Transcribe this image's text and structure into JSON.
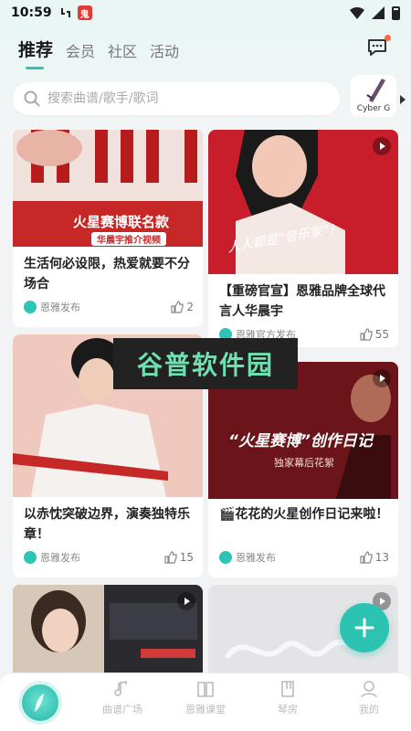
{
  "status_bar": {
    "time": "10:59",
    "app_badge": "鬼"
  },
  "header": {
    "tabs": [
      {
        "label": "推荐"
      },
      {
        "label": "会员"
      },
      {
        "label": "社区"
      },
      {
        "label": "活动"
      }
    ],
    "search_placeholder": "搜索曲谱/歌手/歌词",
    "promo_label": "Cyber G"
  },
  "feed": [
    {
      "title": "生活何必设限，热爱就要不分场合",
      "author": "恩雅发布",
      "likes": "2",
      "overlay_text": "火星赛博联名款",
      "overlay_sub": "华晨宇推介视频"
    },
    {
      "title": "【重磅官宣】恩雅品牌全球代言人华晨宇",
      "author": "恩雅官方发布",
      "likes": "55",
      "overlay_text": "人人都是“音乐家”！"
    },
    {
      "title": "以赤忱突破边界，演奏独特乐章！",
      "author": "恩雅发布",
      "likes": "15"
    },
    {
      "title": "🎬花花的火星创作日记来啦！",
      "author": "恩雅发布",
      "likes": "13",
      "overlay_text": "“火星赛博”创作日记",
      "overlay_sub": "独家幕后花絮"
    },
    {
      "title": "",
      "author": "",
      "likes": ""
    },
    {
      "title": "",
      "author": "",
      "likes": ""
    }
  ],
  "watermark": "谷普软件园",
  "bottom_nav": [
    {
      "label": ""
    },
    {
      "label": "曲谱广场"
    },
    {
      "label": "恩雅课堂"
    },
    {
      "label": "琴房"
    },
    {
      "label": "我的"
    }
  ],
  "colors": {
    "accent": "#2cc5b4",
    "notification": "#ff6a3d"
  }
}
